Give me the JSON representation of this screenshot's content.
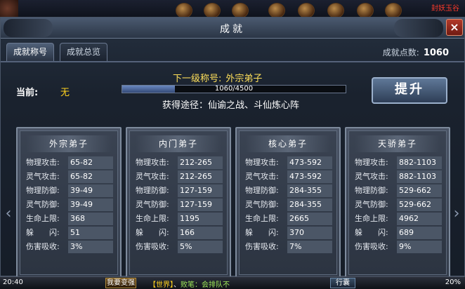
{
  "top_strip": {
    "tag": "封妖玉谷"
  },
  "window": {
    "title": "成就",
    "close_label": "×"
  },
  "tabs": [
    {
      "label": "成就称号",
      "active": true
    },
    {
      "label": "成就总览",
      "active": false
    }
  ],
  "points": {
    "label": "成就点数:",
    "value": "1060"
  },
  "current": {
    "label": "当前:",
    "value": "无"
  },
  "next_title": {
    "label": "下一级称号:",
    "value": "外宗弟子"
  },
  "progress": {
    "text": "1060/4500",
    "current": 1060,
    "max": 4500
  },
  "route": "获得途径：仙谕之战、斗仙炼心阵",
  "upgrade_button": "提升",
  "stat_labels": {
    "phys_atk": "物理攻击:",
    "spirit_atk": "灵气攻击:",
    "phys_def": "物理防御:",
    "spirit_def": "灵气防御:",
    "hp": "生命上限:",
    "dodge": "躲　　闪:",
    "absorb": "伤害吸收:"
  },
  "cards": [
    {
      "title": "外宗弟子",
      "phys_atk": "65-82",
      "spirit_atk": "65-82",
      "phys_def": "39-49",
      "spirit_def": "39-49",
      "hp": "368",
      "dodge": "51",
      "absorb": "3%"
    },
    {
      "title": "内门弟子",
      "phys_atk": "212-265",
      "spirit_atk": "212-265",
      "phys_def": "127-159",
      "spirit_def": "127-159",
      "hp": "1195",
      "dodge": "166",
      "absorb": "5%"
    },
    {
      "title": "核心弟子",
      "phys_atk": "473-592",
      "spirit_atk": "473-592",
      "phys_def": "284-355",
      "spirit_def": "284-355",
      "hp": "2665",
      "dodge": "370",
      "absorb": "7%"
    },
    {
      "title": "天骄弟子",
      "phys_atk": "882-1103",
      "spirit_atk": "882-1103",
      "phys_def": "529-662",
      "spirit_def": "529-662",
      "hp": "4962",
      "dodge": "689",
      "absorb": "9%"
    }
  ],
  "bottom_bar": {
    "time": "20:40",
    "button1": "我要变强",
    "chat_channel": "【世界】",
    "chat_sep": "、",
    "chat_text": "败笔：会排队不",
    "button2": "行囊",
    "percent": "20%"
  }
}
